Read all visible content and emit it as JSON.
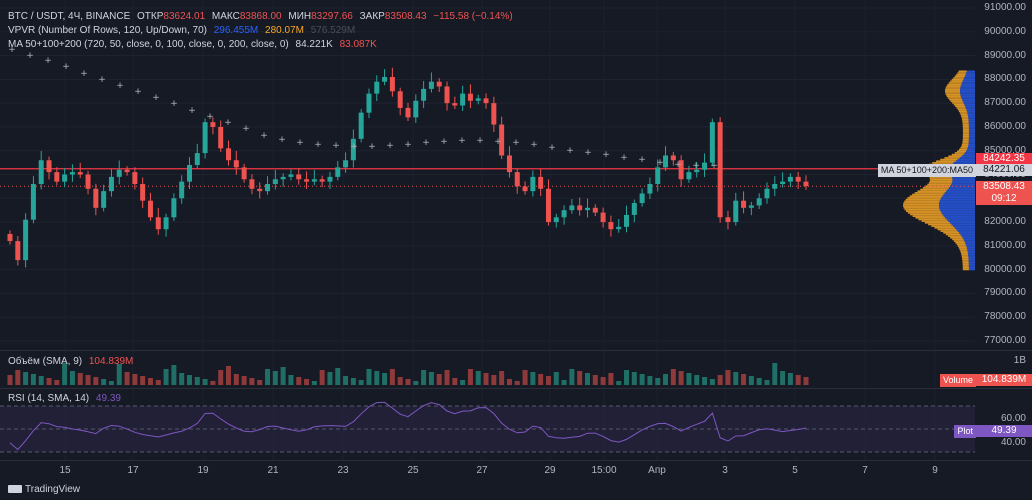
{
  "legend": {
    "symbol": "BTC / USDT, 4Ч, BINANCE",
    "open_label": "ОТКР",
    "open": "83624.01",
    "high_label": "МАКС",
    "high": "83868.00",
    "low_label": "МИН",
    "low": "83297.66",
    "close_label": "ЗАКР",
    "close": "83508.43",
    "change": "−115.58 (−0.14%)",
    "vpvr": "VPVR (Number Of Rows, 120, Up/Down, 70)",
    "vpvr_v1": "296.455M",
    "vpvr_v2": "280.07M",
    "vpvr_v3": "576.529M",
    "ma": "MA 50+100+200 (720, 50, close, 0, 100, close, 0, 200, close, 0)",
    "ma_v1": "84.221K",
    "ma_v2": "83.087K"
  },
  "volume_legend": {
    "label": "Объём (SMA, 9)",
    "value": "104.839M"
  },
  "rsi_legend": {
    "label": "RSI (14, SMA, 14)",
    "value": "49.39"
  },
  "price_axis": {
    "ticks": [
      "91000.00",
      "90000.00",
      "89000.00",
      "88000.00",
      "87000.00",
      "86000.00",
      "85000.00",
      "84000.00",
      "83000.00",
      "82000.00",
      "81000.00",
      "80000.00",
      "79000.00",
      "78000.00",
      "77000.00"
    ],
    "tag_red": "84242.35",
    "tag_ma_label": "MA 50+100+200:MA50",
    "tag_ma": "84221.06",
    "tag_price": "83508.43",
    "tag_timer": "09:12"
  },
  "volume_axis": {
    "tick": "1B",
    "tag_label": "Volume",
    "tag_value": "104.839M"
  },
  "rsi_axis": {
    "ticks": [
      "60.00",
      "40.00"
    ],
    "tag_label": "Plot",
    "tag_value": "49.39"
  },
  "time_axis": [
    "15",
    "17",
    "19",
    "21",
    "23",
    "25",
    "27",
    "29",
    "15:00",
    "Апр",
    "3",
    "5",
    "7",
    "9"
  ],
  "brand": "TradingView",
  "colors": {
    "up": "#26a69a",
    "down": "#ef5350",
    "vpvr_up": "#2962ff",
    "vpvr_down": "#f9a825",
    "rsi": "#7e57c2",
    "red_line": "#f23645"
  },
  "chart_data": {
    "type": "candlestick",
    "title": "BTC / USDT, 4Ч, BINANCE",
    "ylim": [
      76500,
      91200
    ],
    "closes": [
      81200,
      80400,
      82100,
      83600,
      84600,
      84100,
      83700,
      84000,
      84100,
      84000,
      83400,
      82600,
      83300,
      83900,
      84200,
      84100,
      83600,
      82900,
      82200,
      81700,
      82200,
      83000,
      83700,
      84400,
      84900,
      86200,
      86000,
      85100,
      84600,
      84300,
      83800,
      83400,
      83300,
      83600,
      83800,
      83900,
      84000,
      83800,
      83700,
      83800,
      83700,
      83900,
      84300,
      84600,
      85500,
      86600,
      87400,
      87900,
      88100,
      87500,
      86800,
      86400,
      87100,
      87600,
      87900,
      87700,
      87000,
      86900,
      87400,
      87100,
      87200,
      87000,
      86100,
      84800,
      84100,
      83500,
      83300,
      83900,
      83400,
      82000,
      82200,
      82500,
      82700,
      82500,
      82600,
      82400,
      82000,
      81700,
      81800,
      82300,
      82800,
      83200,
      83600,
      84300,
      84800,
      84600,
      83800,
      84100,
      84200,
      84500,
      86200,
      82200,
      82000,
      82900,
      82600,
      82700,
      83000,
      83400,
      83600,
      83700,
      83900,
      83700,
      83508
    ],
    "ma_value": 84221.06,
    "red_line_value": 84242.35,
    "rsi_last": 49.39,
    "volume_last": "104.839M"
  }
}
